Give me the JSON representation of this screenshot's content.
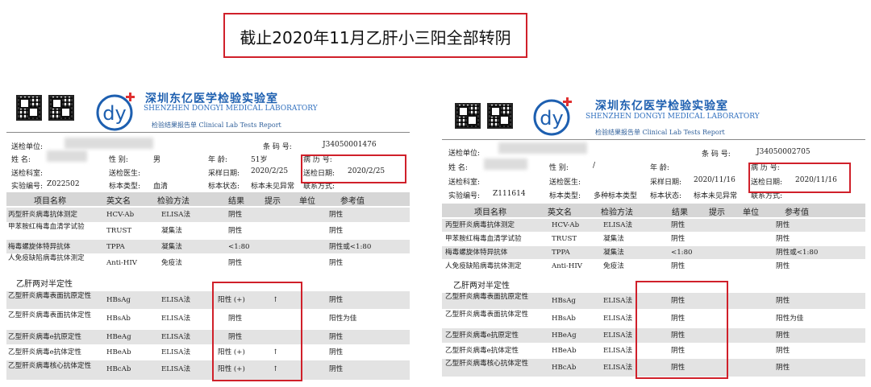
{
  "headline": "截止2020年11月乙肝小三阳全部转阴",
  "lab": {
    "name_cn": "深圳东亿医学检验实验室",
    "name_en": "SHENZHEN DONGYI MEDICAL LABORATORY",
    "subtitle": "检验结果报告单 Clinical Lab Tests Report",
    "logo_text": "dy"
  },
  "labels": {
    "unit": "送检单位:",
    "name": "姓    名:",
    "dept": "送检科室:",
    "exam_no": "实验编号:",
    "barcode": "条    码    号:",
    "gender": "性    别:",
    "doctor": "送检医生:",
    "sample_type": "标本类型:",
    "age": "年    龄:",
    "collect_date": "采样日期:",
    "sample_state": "标本状态:",
    "record_no": "病 历 号:",
    "send_date": "送检日期:",
    "contact": "联系方式:"
  },
  "columns": [
    "项目名称",
    "英文名",
    "检验方法",
    "结果",
    "提示",
    "单位",
    "参考值"
  ],
  "section_title": "乙肝两对半定性",
  "reports": [
    {
      "barcode": "J34050001476",
      "gender": "男",
      "age": "51岁",
      "collect_date": "2020/2/25",
      "send_date": "2020/2/25",
      "exam_no": "Z022502",
      "sample_type": "血清",
      "sample_state": "标本未见异常",
      "tests": [
        {
          "name": "丙型肝炎病毒抗体测定",
          "en": "HCV-Ab",
          "method": "ELISA法",
          "result": "阴性",
          "flag": "",
          "unit": "",
          "ref": "阴性"
        },
        {
          "name": "甲苯胺红梅毒血清学试验",
          "en": "TRUST",
          "method": "凝集法",
          "result": "阴性",
          "flag": "",
          "unit": "",
          "ref": "阴性"
        },
        {
          "name": "梅毒螺旋体特异抗体",
          "en": "TPPA",
          "method": "凝集法",
          "result": "<1:80",
          "flag": "",
          "unit": "",
          "ref": "阴性或<1:80"
        },
        {
          "name": "人免疫缺陷病毒抗体测定",
          "en": "Anti-HIV",
          "method": "免疫法",
          "result": "阴性",
          "flag": "",
          "unit": "",
          "ref": "阴性"
        }
      ],
      "hbv": [
        {
          "name": "乙型肝炎病毒表面抗原定性",
          "en": "HBsAg",
          "method": "ELISA法",
          "result": "阳性 (+)",
          "flag": "↑",
          "unit": "",
          "ref": "阴性"
        },
        {
          "name": "乙型肝炎病毒表面抗体定性",
          "en": "HBsAb",
          "method": "ELISA法",
          "result": "阴性",
          "flag": "",
          "unit": "",
          "ref": "阳性为佳"
        },
        {
          "name": "乙型肝炎病毒e抗原定性",
          "en": "HBeAg",
          "method": "ELISA法",
          "result": "阴性",
          "flag": "",
          "unit": "",
          "ref": "阴性"
        },
        {
          "name": "乙型肝炎病毒e抗体定性",
          "en": "HBeAb",
          "method": "ELISA法",
          "result": "阳性 (+)",
          "flag": "↑",
          "unit": "",
          "ref": "阴性"
        },
        {
          "name": "乙型肝炎病毒核心抗体定性",
          "en": "HBcAb",
          "method": "ELISA法",
          "result": "阳性 (+)",
          "flag": "↑",
          "unit": "",
          "ref": "阴性"
        }
      ]
    },
    {
      "barcode": "J34050002705",
      "gender": "/",
      "age": "",
      "collect_date": "2020/11/16",
      "send_date": "2020/11/16",
      "exam_no": "Z111614",
      "sample_type": "多种标本类型",
      "sample_state": "标本未见异常",
      "tests": [
        {
          "name": "丙型肝炎病毒抗体测定",
          "en": "HCV-Ab",
          "method": "ELISA法",
          "result": "阴性",
          "flag": "",
          "unit": "",
          "ref": "阴性"
        },
        {
          "name": "甲苯胺红梅毒血清学试验",
          "en": "TRUST",
          "method": "凝集法",
          "result": "阴性",
          "flag": "",
          "unit": "",
          "ref": "阴性"
        },
        {
          "name": "梅毒螺旋体特异抗体",
          "en": "TPPA",
          "method": "凝集法",
          "result": "<1:80",
          "flag": "",
          "unit": "",
          "ref": "阴性或<1:80"
        },
        {
          "name": "人免疫缺陷病毒抗体测定",
          "en": "Anti-HIV",
          "method": "免疫法",
          "result": "阴性",
          "flag": "",
          "unit": "",
          "ref": "阴性"
        }
      ],
      "hbv": [
        {
          "name": "乙型肝炎病毒表面抗原定性",
          "en": "HBsAg",
          "method": "ELISA法",
          "result": "阴性",
          "flag": "",
          "unit": "",
          "ref": "阴性"
        },
        {
          "name": "乙型肝炎病毒表面抗体定性",
          "en": "HBsAb",
          "method": "ELISA法",
          "result": "阴性",
          "flag": "",
          "unit": "",
          "ref": "阳性为佳"
        },
        {
          "name": "乙型肝炎病毒e抗原定性",
          "en": "HBeAg",
          "method": "ELISA法",
          "result": "阴性",
          "flag": "",
          "unit": "",
          "ref": "阴性"
        },
        {
          "name": "乙型肝炎病毒e抗体定性",
          "en": "HBeAb",
          "method": "ELISA法",
          "result": "阴性",
          "flag": "",
          "unit": "",
          "ref": "阴性"
        },
        {
          "name": "乙型肝炎病毒核心抗体定性",
          "en": "HBcAb",
          "method": "ELISA法",
          "result": "阴性",
          "flag": "",
          "unit": "",
          "ref": "阴性"
        }
      ]
    }
  ],
  "colors": {
    "highlight": "#d0202a",
    "brand_blue": "#1d5fb0",
    "logo_red": "#e03030",
    "row_shade": "#e3e3e3",
    "header_shade": "#d6d6d6"
  }
}
